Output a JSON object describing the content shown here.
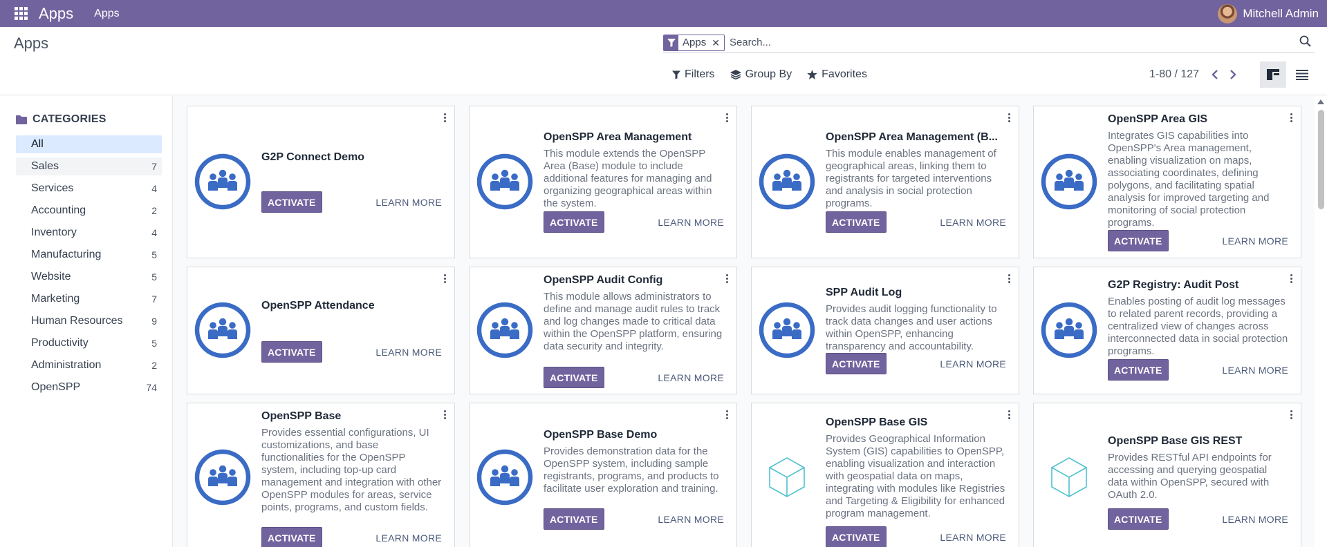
{
  "navbar": {
    "brand": "Apps",
    "menu_item": "Apps",
    "user_name": "Mitchell Admin",
    "bg_color": "#71639e"
  },
  "control_panel": {
    "title": "Apps",
    "search_facet": "Apps",
    "search_placeholder": "Search...",
    "filters_label": "Filters",
    "group_by_label": "Group By",
    "favorites_label": "Favorites",
    "pager": "1-80 / 127"
  },
  "sidebar": {
    "header": "CATEGORIES",
    "items": [
      {
        "label": "All",
        "count": ""
      },
      {
        "label": "Sales",
        "count": "7"
      },
      {
        "label": "Services",
        "count": "4"
      },
      {
        "label": "Accounting",
        "count": "2"
      },
      {
        "label": "Inventory",
        "count": "4"
      },
      {
        "label": "Manufacturing",
        "count": "5"
      },
      {
        "label": "Website",
        "count": "5"
      },
      {
        "label": "Marketing",
        "count": "7"
      },
      {
        "label": "Human Resources",
        "count": "9"
      },
      {
        "label": "Productivity",
        "count": "5"
      },
      {
        "label": "Administration",
        "count": "2"
      },
      {
        "label": "OpenSPP",
        "count": "74"
      }
    ]
  },
  "buttons": {
    "activate": "ACTIVATE",
    "learn_more": "LEARN MORE"
  },
  "apps": [
    {
      "title": "G2P Connect Demo",
      "description": "",
      "icon": "people-icon"
    },
    {
      "title": "OpenSPP Area Management",
      "description": "This module extends the OpenSPP Area (Base) module to include additional features for managing and organizing geographical areas within the system.",
      "icon": "people-icon"
    },
    {
      "title": "OpenSPP Area Management (B...",
      "description": "This module enables management of geographical areas, linking them to registrants for targeted interventions and analysis in social protection programs.",
      "icon": "people-icon"
    },
    {
      "title": "OpenSPP Area GIS",
      "description": "Integrates GIS capabilities into OpenSPP's Area management, enabling visualization on maps, associating coordinates, defining polygons, and facilitating spatial analysis for improved targeting and monitoring of social protection programs.",
      "icon": "people-icon"
    },
    {
      "title": "OpenSPP Attendance",
      "description": "",
      "icon": "people-icon"
    },
    {
      "title": "OpenSPP Audit Config",
      "description": "This module allows administrators to define and manage audit rules to track and log changes made to critical data within the OpenSPP platform, ensuring data security and integrity.",
      "icon": "people-icon"
    },
    {
      "title": "SPP Audit Log",
      "description": "Provides audit logging functionality to track data changes and user actions within OpenSPP, enhancing transparency and accountability.",
      "icon": "people-icon"
    },
    {
      "title": "G2P Registry: Audit Post",
      "description": "Enables posting of audit log messages to related parent records, providing a centralized view of changes across interconnected data in social protection programs.",
      "icon": "people-icon"
    },
    {
      "title": "OpenSPP Base",
      "description": "Provides essential configurations, UI customizations, and base functionalities for the OpenSPP system, including top-up card management and integration with other OpenSPP modules for areas, service points, programs, and custom fields.",
      "icon": "people-icon"
    },
    {
      "title": "OpenSPP Base Demo",
      "description": "Provides demonstration data for the OpenSPP system, including sample registrants, programs, and products to facilitate user exploration and training.",
      "icon": "people-icon"
    },
    {
      "title": "OpenSPP Base GIS",
      "description": "Provides Geographical Information System (GIS) capabilities to OpenSPP, enabling visualization and interaction with geospatial data on maps, integrating with modules like Registries and Targeting & Eligibility for enhanced program management.",
      "icon": "cube-icon"
    },
    {
      "title": "OpenSPP Base GIS REST",
      "description": "Provides RESTful API endpoints for accessing and querying geospatial data within OpenSPP, secured with OAuth 2.0.",
      "icon": "cube-icon"
    }
  ]
}
